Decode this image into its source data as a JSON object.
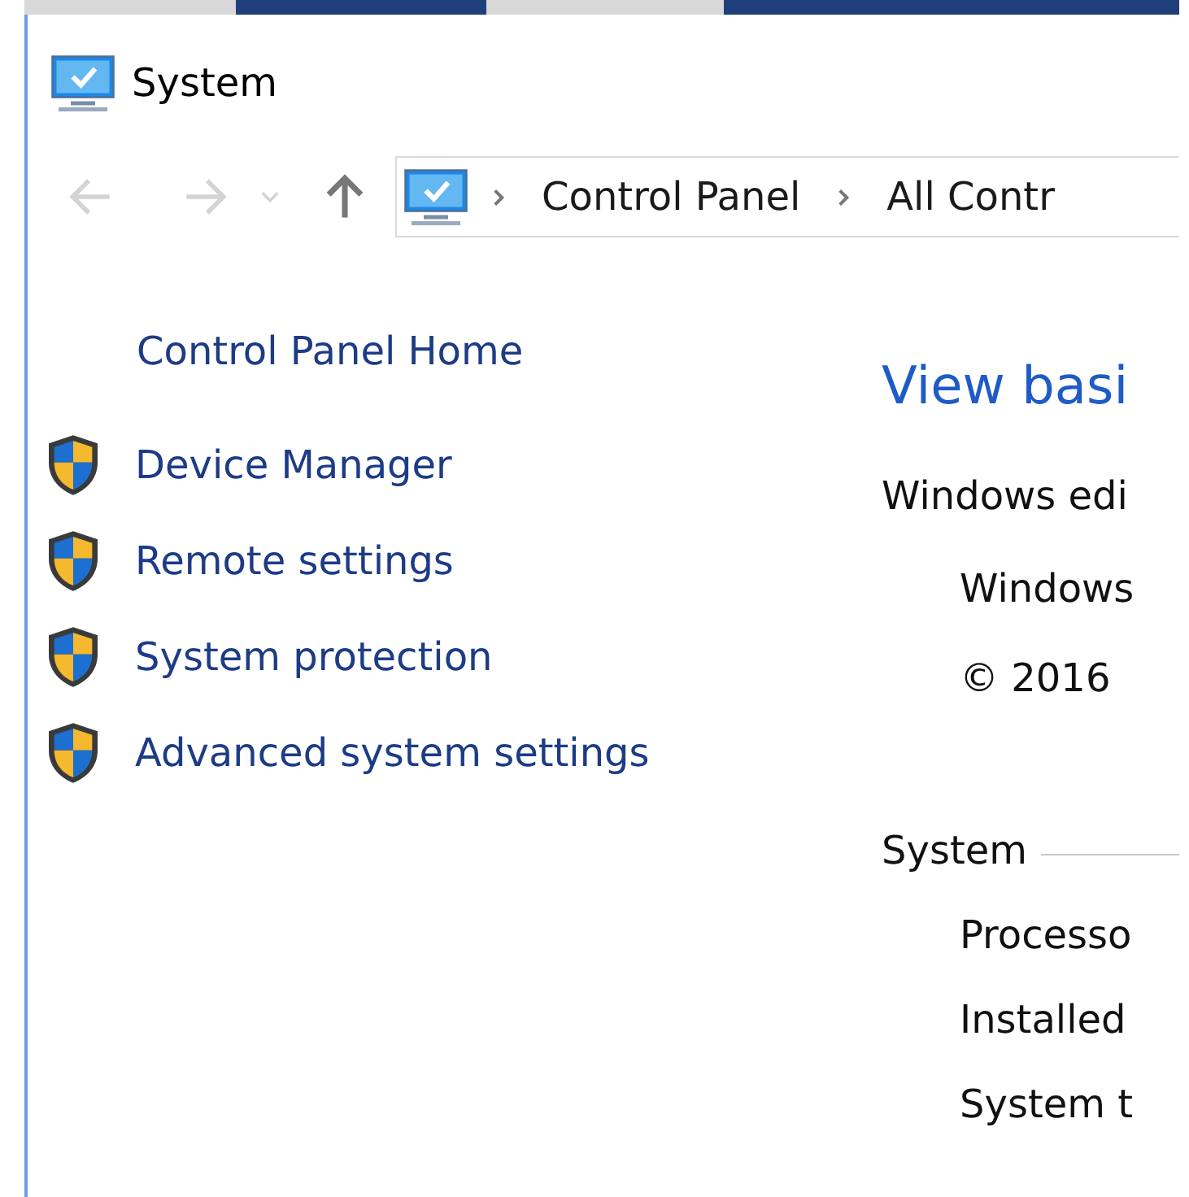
{
  "window": {
    "title": "System"
  },
  "navigation": {
    "address_bar": {
      "crumbs": [
        "Control Panel",
        "All Contr"
      ]
    }
  },
  "sidebar": {
    "home_link": "Control Panel Home",
    "items": [
      {
        "label": "Device Manager"
      },
      {
        "label": "Remote settings"
      },
      {
        "label": "System protection"
      },
      {
        "label": "Advanced system settings"
      }
    ]
  },
  "main": {
    "heading": "View basi",
    "edition": {
      "title": "Windows edi",
      "lines": [
        "Windows",
        "© 2016"
      ]
    },
    "system": {
      "title": "System",
      "lines": [
        "Processo",
        "Installed",
        "System t"
      ]
    }
  }
}
